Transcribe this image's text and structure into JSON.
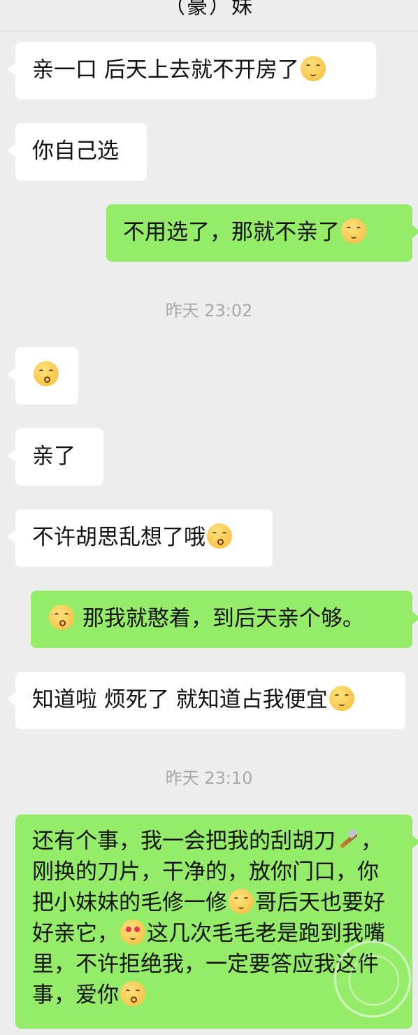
{
  "header": {
    "title": "（豪）妹"
  },
  "messages": [
    {
      "text": "亲一口 后天上去就不开房了",
      "emoji": "squinting-face-emoji"
    },
    {
      "text": "你自己选"
    },
    {
      "text": "不用选了，那就不亲了",
      "emoji": "sweat-face-emoji"
    },
    {
      "timestamp": "昨天 23:02"
    },
    {
      "emoji": "kissing-face-emoji"
    },
    {
      "text": "亲了"
    },
    {
      "text": "不许胡思乱想了哦",
      "emoji": "kissing-face-emoji"
    },
    {
      "text": "那我就憨着，到后天亲个够。",
      "emoji": "blowing-kiss-emoji"
    },
    {
      "text": "知道啦 烦死了 就知道占我便宜",
      "emoji": "thinking-face-emoji"
    },
    {
      "timestamp": "昨天 23:10"
    },
    {
      "text_parts": [
        "还有个事，我一会把我的刮胡刀",
        "，刚换的刀片，干净的，放你门口，你把小妹妹的毛修一修",
        "哥后天也要好好亲它，",
        "这几次毛毛老是跑到我嘴里，不许拒绝我，一定要答应我这件事，爱你"
      ],
      "emojis": [
        "razor-emoji",
        "smiling-face-emoji",
        "heart-eyes-emoji",
        "blowing-kiss-emoji"
      ]
    }
  ]
}
